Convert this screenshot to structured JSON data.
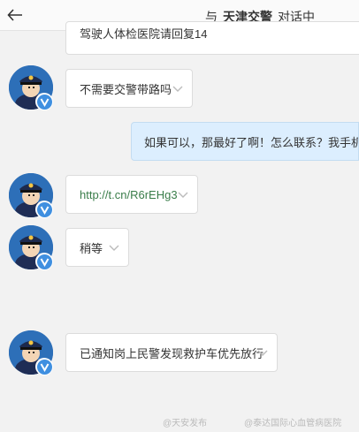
{
  "header": {
    "prefix": "与",
    "name": "天津交警",
    "suffix": "对话中"
  },
  "messages": [
    {
      "text": "驾驶人体检医院请回复14"
    },
    {
      "text": "不需要交警带路吗"
    },
    {
      "text": "如果可以，那最好了啊！怎么联系？我手机号"
    },
    {
      "text": "http://t.cn/R6rEHg3"
    },
    {
      "text": "稍等"
    },
    {
      "text": "已通知岗上民警发现救护车优先放行"
    }
  ],
  "watermarks": {
    "left": "@天安发布",
    "right": "@泰达国际心血管病医院"
  },
  "colors": {
    "incoming_bubble": "#ffffff",
    "outgoing_bubble": "#dceefe",
    "link": "#3a7d4a",
    "verified_badge": "#3f8fe0"
  },
  "icons": {
    "back": "arrow-left-icon",
    "expand": "chevron-down-icon",
    "verified": "verified-badge-icon"
  }
}
